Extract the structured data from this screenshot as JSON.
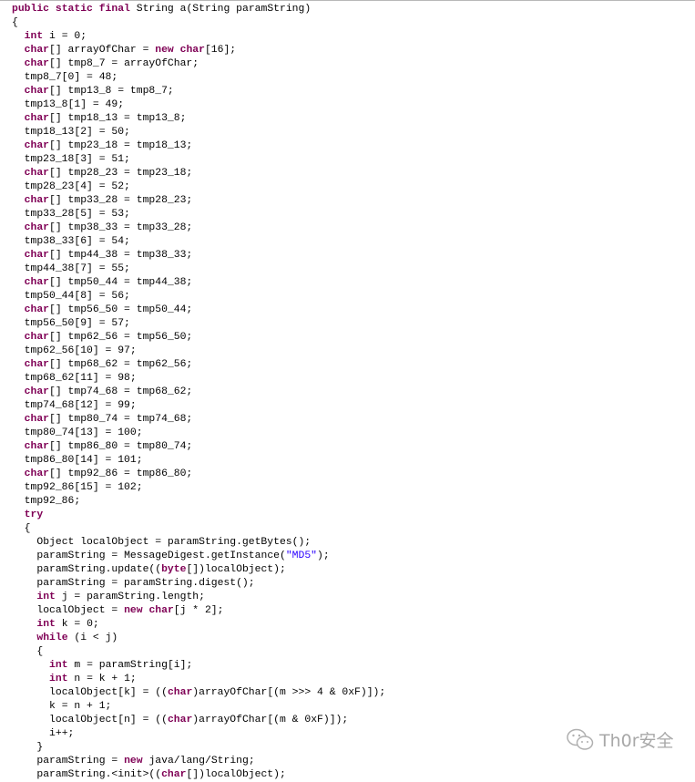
{
  "colors": {
    "keyword": "#7f0055",
    "string": "#2a00ff",
    "text": "#000000"
  },
  "keywords": [
    "public",
    "static",
    "final",
    "int",
    "char",
    "new",
    "try",
    "while",
    "byte"
  ],
  "code_lines": [
    "public static final String a(String paramString)",
    "{",
    "  int i = 0;",
    "  char[] arrayOfChar = new char[16];",
    "  char[] tmp8_7 = arrayOfChar;",
    "  tmp8_7[0] = 48;",
    "  char[] tmp13_8 = tmp8_7;",
    "  tmp13_8[1] = 49;",
    "  char[] tmp18_13 = tmp13_8;",
    "  tmp18_13[2] = 50;",
    "  char[] tmp23_18 = tmp18_13;",
    "  tmp23_18[3] = 51;",
    "  char[] tmp28_23 = tmp23_18;",
    "  tmp28_23[4] = 52;",
    "  char[] tmp33_28 = tmp28_23;",
    "  tmp33_28[5] = 53;",
    "  char[] tmp38_33 = tmp33_28;",
    "  tmp38_33[6] = 54;",
    "  char[] tmp44_38 = tmp38_33;",
    "  tmp44_38[7] = 55;",
    "  char[] tmp50_44 = tmp44_38;",
    "  tmp50_44[8] = 56;",
    "  char[] tmp56_50 = tmp50_44;",
    "  tmp56_50[9] = 57;",
    "  char[] tmp62_56 = tmp56_50;",
    "  tmp62_56[10] = 97;",
    "  char[] tmp68_62 = tmp62_56;",
    "  tmp68_62[11] = 98;",
    "  char[] tmp74_68 = tmp68_62;",
    "  tmp74_68[12] = 99;",
    "  char[] tmp80_74 = tmp74_68;",
    "  tmp80_74[13] = 100;",
    "  char[] tmp86_80 = tmp80_74;",
    "  tmp86_80[14] = 101;",
    "  char[] tmp92_86 = tmp86_80;",
    "  tmp92_86[15] = 102;",
    "  tmp92_86;",
    "  try",
    "  {",
    "    Object localObject = paramString.getBytes();",
    "    paramString = MessageDigest.getInstance(\"MD5\");",
    "    paramString.update((byte[])localObject);",
    "    paramString = paramString.digest();",
    "    int j = paramString.length;",
    "    localObject = new char[j * 2];",
    "    int k = 0;",
    "    while (i < j)",
    "    {",
    "      int m = paramString[i];",
    "      int n = k + 1;",
    "      localObject[k] = ((char)arrayOfChar[(m >>> 4 & 0xF)]);",
    "      k = n + 1;",
    "      localObject[n] = ((char)arrayOfChar[(m & 0xF)]);",
    "      i++;",
    "    }",
    "    paramString = new java/lang/String;",
    "    paramString.<init>((char[])localObject);"
  ],
  "watermark": {
    "icon": "wechat-icon",
    "text": "Th0r安全"
  }
}
